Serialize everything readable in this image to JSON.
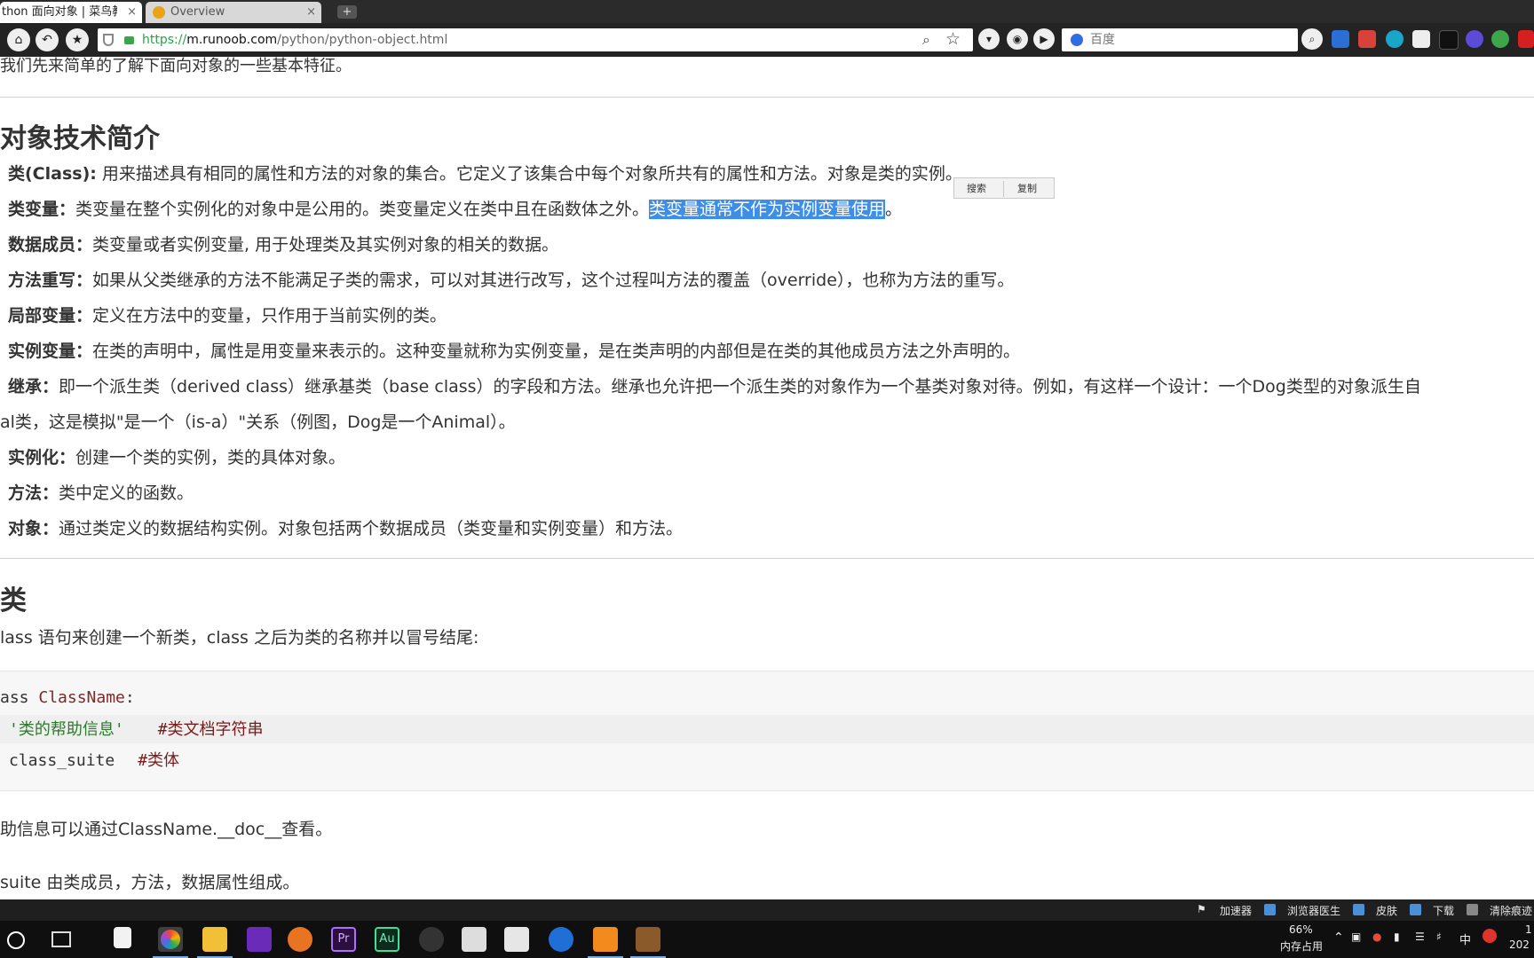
{
  "tabs": [
    {
      "title": "thon 面向对象 | 菜鸟教程",
      "close": "×"
    },
    {
      "title": "Overview",
      "close": "×"
    }
  ],
  "new_tab": "+",
  "nav": {
    "home": "⌂",
    "back": "↶",
    "fav": "★"
  },
  "address": {
    "scheme": "https://",
    "domain": "m.runoob.com",
    "path": "/python/python-object.html"
  },
  "search": {
    "placeholder": "百度"
  },
  "page": {
    "intro": "我们先来简单的了解下面向对象的一些基本特征。",
    "section1_title": "对象技术简介",
    "items": [
      {
        "term": "类(Class):",
        "desc": " 用来描述具有相同的属性和方法的对象的集合。它定义了该集合中每个对象所共有的属性和方法。对象是类的实例。"
      },
      {
        "term": "类变量：",
        "desc": "类变量在整个实例化的对象中是公用的。类变量定义在类中且在函数体之外。",
        "highlight": "类变量通常不作为实例变量使用",
        "tail": "。"
      },
      {
        "term": "数据成员：",
        "desc": "类变量或者实例变量, 用于处理类及其实例对象的相关的数据。"
      },
      {
        "term": "方法重写：",
        "desc": "如果从父类继承的方法不能满足子类的需求，可以对其进行改写，这个过程叫方法的覆盖（override），也称为方法的重写。"
      },
      {
        "term": "局部变量：",
        "desc": "定义在方法中的变量，只作用于当前实例的类。"
      },
      {
        "term": "实例变量：",
        "desc": "在类的声明中，属性是用变量来表示的。这种变量就称为实例变量，是在类声明的内部但是在类的其他成员方法之外声明的。"
      },
      {
        "term": "继承：",
        "desc": "即一个派生类（derived class）继承基类（base class）的字段和方法。继承也允许把一个派生类的对象作为一个基类对象对待。例如，有这样一个设计：一个Dog类型的对象派生自",
        "cont": "al类，这是模拟\"是一个（is-a）\"关系（例图，Dog是一个Animal）。"
      },
      {
        "term": "实例化：",
        "desc": "创建一个类的实例，类的具体对象。"
      },
      {
        "term": "方法：",
        "desc": "类中定义的函数。"
      },
      {
        "term": "对象：",
        "desc": "通过类定义的数据结构实例。对象包括两个数据成员（类变量和实例变量）和方法。"
      }
    ],
    "context_menu": {
      "search": "搜索",
      "copy": "复制"
    },
    "section2_title": "类",
    "section2_intro": "lass 语句来创建一个新类，class 之后为类的名称并以冒号结尾:",
    "code": {
      "line1_kw": "ass ",
      "line1_name": "ClassName",
      "line1_end": ":",
      "line2_str": "'类的帮助信息'",
      "line2_cmt": "#类文档字符串",
      "line3_code": "class_suite",
      "line3_cmt": "#类体"
    },
    "after1": "助信息可以通过ClassName.__doc__查看。",
    "after2": "suite 由类成员，方法，数据属性组成。"
  },
  "statusbar": {
    "accelerator": "加速器",
    "doctor": "浏览器医生",
    "skin": "皮肤",
    "download": "下载",
    "clear": "清除痕迹"
  },
  "taskbar": {
    "memory_pct": "66%",
    "memory_label": "内存占用",
    "ime": "中",
    "clock_top": "1",
    "clock_bottom": "202"
  }
}
